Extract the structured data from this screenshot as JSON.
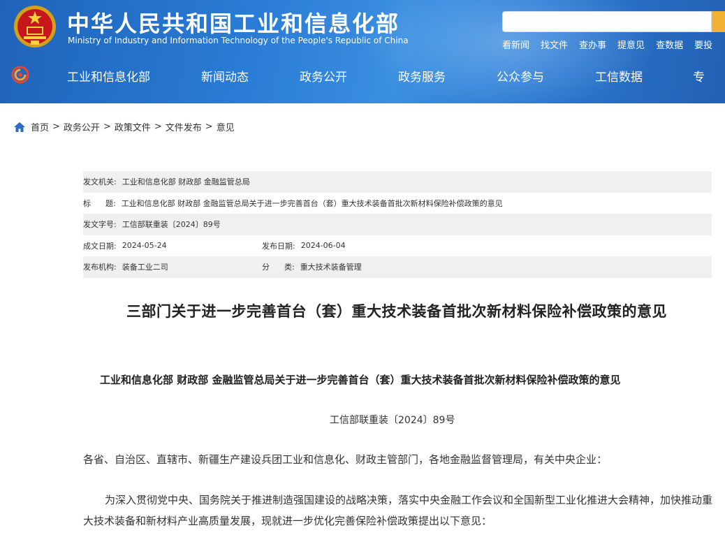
{
  "header": {
    "site_title": "中华人民共和国工业和信息化部",
    "site_subtitle": "Ministry of Industry and Information Technology of the People's Republic of China",
    "search": {
      "placeholder": ""
    },
    "quick_links": [
      "看新闻",
      "找文件",
      "查办事",
      "提意见",
      "查数据",
      "要投"
    ],
    "nav": [
      "工业和信息化部",
      "新闻动态",
      "政务公开",
      "政务服务",
      "公众参与",
      "工信数据",
      "专"
    ],
    "colors": {
      "header_blue": "#2a7cd6",
      "search_button": "#f2b233"
    }
  },
  "breadcrumb": [
    "首页",
    "政务公开",
    "政策文件",
    "文件发布",
    "意见"
  ],
  "meta": {
    "issuer_label": "发文机关:",
    "issuer": "工业和信息化部 财政部 金融监管总局",
    "title_label": "标      题:",
    "title": "工业和信息化部 财政部 金融监管总局关于进一步完善首台（套）重大技术装备首批次新材料保险补偿政策的意见",
    "doc_no_label": "发文字号:",
    "doc_no": "工信部联重装〔2024〕89号",
    "created_label": "成文日期:",
    "created": "2024-05-24",
    "published_label": "发布日期:",
    "published": "2024-06-04",
    "org_label": "发布机构:",
    "org": "装备工业二司",
    "category_label": "分      类:",
    "category": "重大技术装备管理"
  },
  "article": {
    "title": "三部门关于进一步完善首台（套）重大技术装备首批次新材料保险补偿政策的意见",
    "subtitle": "工业和信息化部 财政部 金融监管总局关于进一步完善首台（套）重大技术装备首批次新材料保险补偿政策的意见",
    "doc_number": "工信部联重装〔2024〕89号",
    "paragraphs": [
      "各省、自治区、直辖市、新疆生产建设兵团工业和信息化、财政主管部门，各地金融监督管理局，有关中央企业：",
      "为深入贯彻党中央、国务院关于推进制造强国建设的战略决策，落实中央金融工作会议和全国新型工业化推进大会精神，加快推动重大技术装备和新材料产业高质量发展，现就进一步优化完善保险补偿政策提出以下意见："
    ]
  }
}
